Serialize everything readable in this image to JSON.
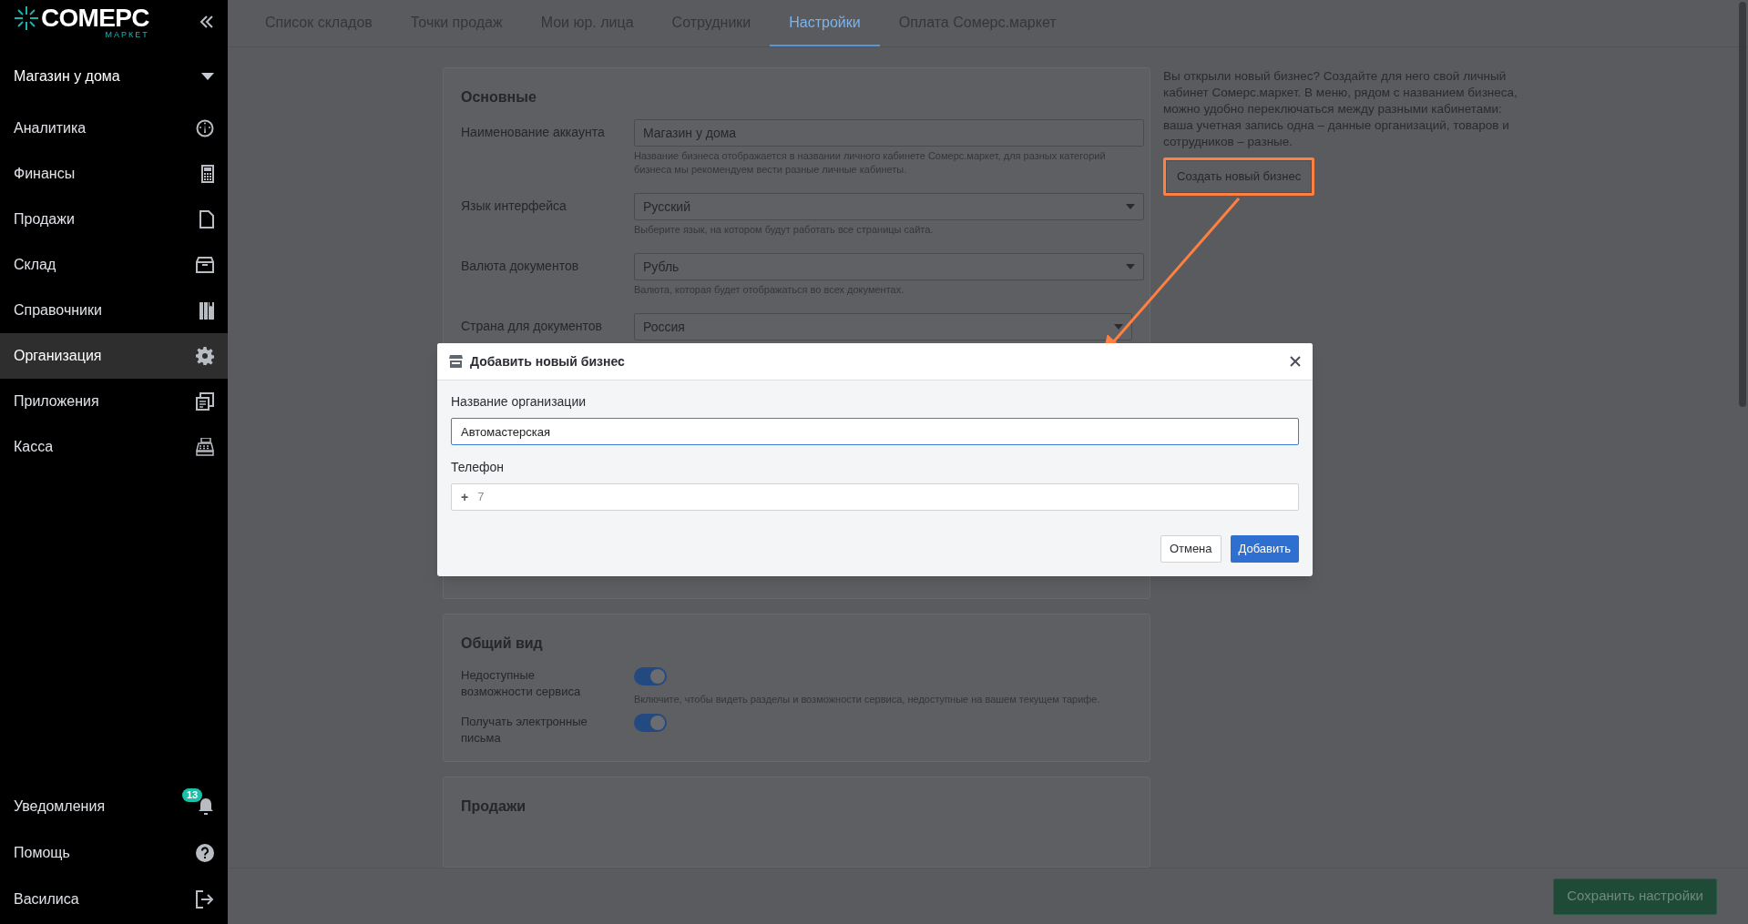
{
  "sidebar": {
    "logo": {
      "title": "COMEPC",
      "subtitle": "МАРКЕТ"
    },
    "account": "Магазин у дома",
    "items": [
      {
        "label": "Аналитика",
        "selected": false
      },
      {
        "label": "Финансы",
        "selected": false
      },
      {
        "label": "Продажи",
        "selected": false
      },
      {
        "label": "Склад",
        "selected": false
      },
      {
        "label": "Справочники",
        "selected": false
      },
      {
        "label": "Организация",
        "selected": true
      },
      {
        "label": "Приложения",
        "selected": false
      },
      {
        "label": "Касса",
        "selected": false
      }
    ],
    "notifications": {
      "label": "Уведомления",
      "badge": "13"
    },
    "help": "Помощь",
    "user": "Василиса"
  },
  "tabs": [
    {
      "label": "Список складов",
      "selected": false
    },
    {
      "label": "Точки продаж",
      "selected": false
    },
    {
      "label": "Мои юр. лица",
      "selected": false
    },
    {
      "label": "Сотрудники",
      "selected": false
    },
    {
      "label": "Настройки",
      "selected": true
    },
    {
      "label": "Оплата Сомерс.маркет",
      "selected": false
    }
  ],
  "basic": {
    "title": "Основные",
    "fields": [
      {
        "kind": "text",
        "label": "Наименование аккаунта",
        "value": "Магазин у дома",
        "hint": "Название бизнеса отображается в названии личного кабинете Сомерс.маркет, для разных категорий бизнеса мы рекомендуем вести разные личные кабинеты."
      },
      {
        "kind": "select",
        "label": "Язык интерфейса",
        "value": "Русский",
        "hint": "Выберите язык, на котором будут работать все страницы сайта."
      },
      {
        "kind": "select",
        "label": "Валюта документов",
        "value": "Рубль",
        "hint": "Валюта, которая будет отображаться во всех документах."
      },
      {
        "kind": "select",
        "label": "Страна для документов",
        "value": "Россия"
      }
    ]
  },
  "general": {
    "title": "Общий вид",
    "toggles": [
      {
        "label": "Недоступные возможности сервиса",
        "on": true,
        "hint": "Включите, чтобы видеть разделы и возможности сервиса, недоступные на вашем текущем тарифе."
      },
      {
        "label": "Получать электронные письма",
        "on": true
      }
    ]
  },
  "sales": {
    "title": "Продажи"
  },
  "side_note": {
    "text": "Вы открыли новый бизнес? Создайте для него свой личный кабинет Сомерс.маркет. В меню, рядом с названием бизнеса, можно удобно переключаться между разными кабинетами: ваша учетная запись одна – данные организаций, товаров и сотрудников – разные.",
    "button": "Создать новый бизнес"
  },
  "modal": {
    "title": "Добавить новый бизнес",
    "name_field": {
      "label": "Название организации",
      "value": "Автомастерская"
    },
    "phone_field": {
      "label": "Телефон",
      "prefix": "+",
      "placeholder": "7"
    },
    "cancel": "Отмена",
    "submit": "Добавить"
  },
  "save_button": "Сохранить настройки"
}
